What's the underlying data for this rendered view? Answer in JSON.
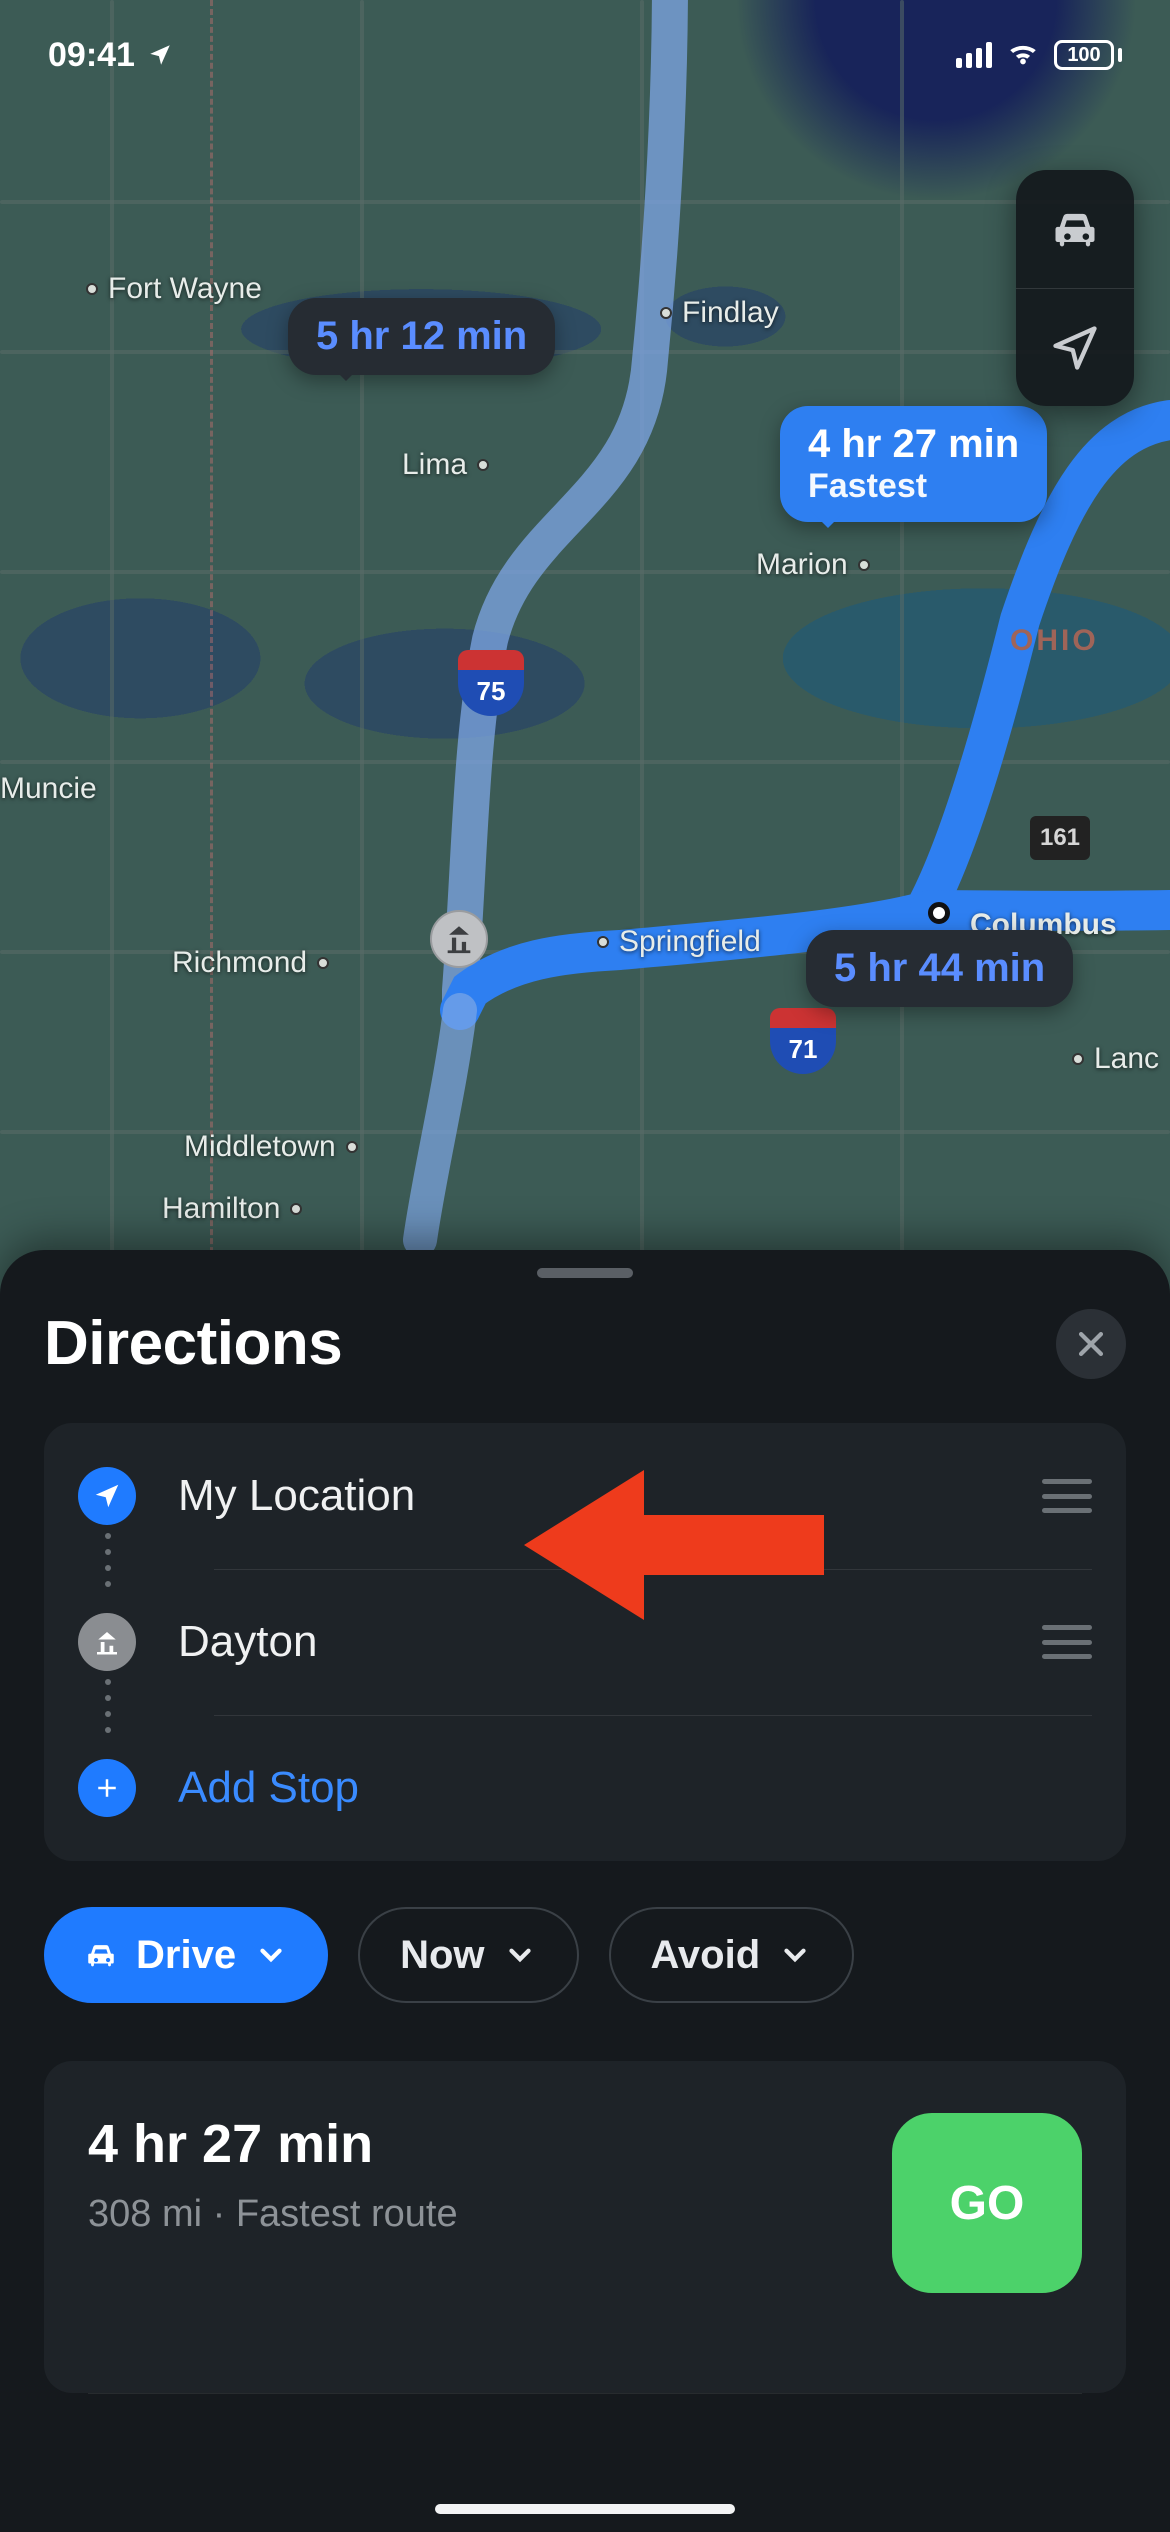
{
  "status": {
    "time": "09:41",
    "battery": "100"
  },
  "map": {
    "cities": {
      "fortwayne": "Fort Wayne",
      "findlay": "Findlay",
      "lima": "Lima",
      "marion": "Marion",
      "muncie": "Muncie",
      "springfield": "Springfield",
      "richmond": "Richmond",
      "middletown": "Middletown",
      "hamilton": "Hamilton",
      "columbus": "Columbus",
      "lancaster": "Lanc"
    },
    "state": "OHIO",
    "shield75": "75",
    "shield71": "71",
    "usshield161": "161",
    "callouts": {
      "alt1": "5 hr 12 min",
      "fastest_time": "4 hr 27 min",
      "fastest_label": "Fastest",
      "alt2": "5 hr 44 min"
    },
    "controls": {
      "mode": "car",
      "locate": "locate"
    }
  },
  "sheet": {
    "title": "Directions",
    "stops": {
      "origin": "My Location",
      "destination": "Dayton",
      "add": "Add Stop"
    },
    "chips": {
      "mode": "Drive",
      "when": "Now",
      "avoid": "Avoid"
    },
    "route": {
      "time": "4 hr 27 min",
      "subtitle": "308 mi · Fastest route",
      "go": "GO"
    }
  }
}
